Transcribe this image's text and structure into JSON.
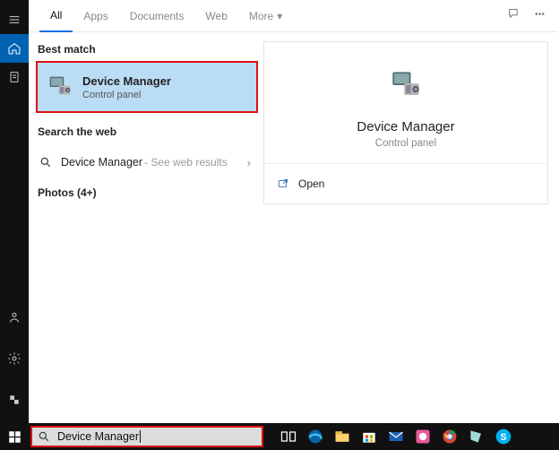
{
  "tabs": {
    "all": "All",
    "apps": "Apps",
    "documents": "Documents",
    "web": "Web",
    "more": "More"
  },
  "sections": {
    "best_match": "Best match",
    "search_web": "Search the web",
    "photos": "Photos (4+)"
  },
  "best_match_item": {
    "title": "Device Manager",
    "subtitle": "Control panel"
  },
  "web_result": {
    "text": "Device Manager",
    "suffix": "- See web results"
  },
  "preview": {
    "title": "Device Manager",
    "subtitle": "Control panel",
    "open": "Open"
  },
  "search": {
    "value": "Device Manager"
  }
}
